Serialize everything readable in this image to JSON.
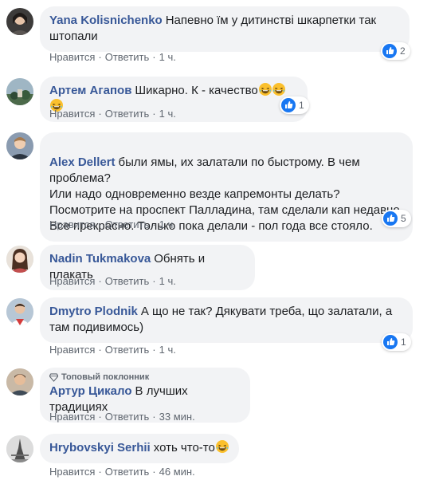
{
  "actions": {
    "like": "Нравится",
    "reply": "Ответить",
    "dot": "·"
  },
  "colors": {
    "author": "#385898",
    "bubble": "#f2f3f5",
    "meta": "#606770",
    "like_blue": "#1877f2"
  },
  "comments": [
    {
      "author": "Yana Kolisnichenko",
      "text": "Напевно їм у дитинстві шкарпетки так штопали",
      "reaction_icon": "like-icon",
      "reaction_count": "2",
      "time": "1 ч."
    },
    {
      "author": "Артем Агапов",
      "text": "Шикарно. К - качество",
      "emoji": "laughing-emoji",
      "reaction_icon": "like-icon",
      "reaction_count": "1",
      "time": "1 ч."
    },
    {
      "author": "Alex Dellert",
      "text": "были ямы, их залатали по быстрому. В чем проблема?\nИли надо одновременно везде капремонты делать?\nПосмотрите на проспект Палладина, там сделали кап недавно.\nВсе прекрасно. Только пока делали - пол года все стояло.",
      "reaction_icon": "like-icon",
      "reaction_count": "5",
      "time": "1 ч."
    },
    {
      "author": "Nadin Tukmakova",
      "text": "Обнять и плакать",
      "time": "1 ч."
    },
    {
      "author": "Dmytro Plodnik",
      "text": "А що не так? Дякувати треба, що залатали, а там подивимось)",
      "reaction_icon": "like-icon",
      "reaction_count": "1",
      "time": "1 ч."
    },
    {
      "author": "Артур Цикало",
      "badge": "Топовый поклонник",
      "badge_icon": "diamond-icon",
      "text": "В лучших традициях",
      "time": "33 мин."
    },
    {
      "author": "Hrybovskyi Serhii",
      "text": "хоть что-то",
      "emoji": "laughing-emoji",
      "time": "46 мин."
    }
  ]
}
